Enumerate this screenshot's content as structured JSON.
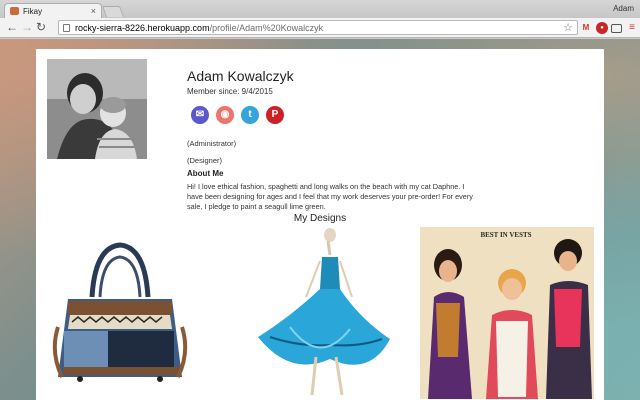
{
  "browser": {
    "tab_title": "Fikay",
    "tab_close": "×",
    "user": "Adam",
    "url_host": "rocky-sierra-8226.herokuapp.com",
    "url_path": "/profile/Adam%20Kowalczyk",
    "icons": [
      "back-icon",
      "forward-icon",
      "reload-icon",
      "star-icon",
      "gmail-icon",
      "extension-badge-icon",
      "cast-icon",
      "menu-icon"
    ]
  },
  "profile": {
    "name": "Adam Kowalczyk",
    "member_since": "Member since: 9/4/2015",
    "roles": [
      "(Administrator)",
      "(Designer)"
    ],
    "about_heading": "About Me",
    "bio": "Hi! I love ethical fashion, spaghetti and long walks on the beach with my cat Daphne. I have been designing for ages and I feel that my work deserves your pre-order! For every sale, I pledge to paint a seagull lime green.",
    "social": [
      {
        "name": "email-icon",
        "color": "#5b58c9"
      },
      {
        "name": "contact-icon",
        "color": "#e8766c"
      },
      {
        "name": "twitter-icon",
        "color": "#35a3dc"
      },
      {
        "name": "pinterest-icon",
        "color": "#cc2127"
      }
    ]
  },
  "designs": {
    "heading": "My Designs",
    "items": [
      {
        "name": "design-bag"
      },
      {
        "name": "design-dress"
      },
      {
        "name": "design-poster",
        "poster_text": "BEST IN VESTS"
      }
    ]
  }
}
